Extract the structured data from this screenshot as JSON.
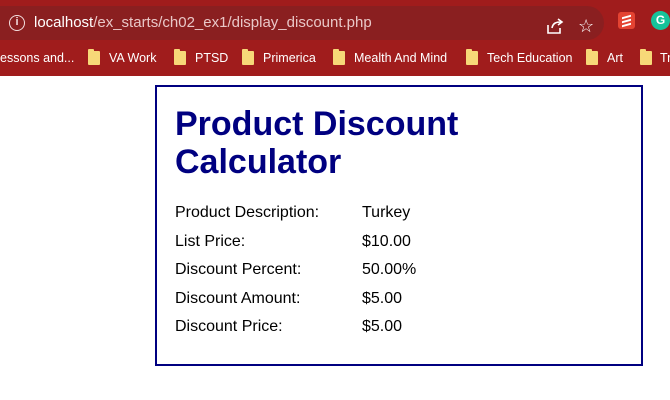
{
  "browser": {
    "url_host": "localhost",
    "url_path": "/ex_starts/ch02_ex1/display_discount.php",
    "extension_grammarly_letter": "G"
  },
  "bookmarks": [
    {
      "label": "essons and...",
      "folder": false
    },
    {
      "label": "VA Work",
      "folder": true
    },
    {
      "label": "PTSD",
      "folder": true
    },
    {
      "label": "Primerica",
      "folder": true
    },
    {
      "label": "Mealth And Mind",
      "folder": true
    },
    {
      "label": "Tech Education",
      "folder": true
    },
    {
      "label": "Art",
      "folder": true
    },
    {
      "label": "Tr",
      "folder": true
    }
  ],
  "page": {
    "title": "Product Discount Calculator",
    "rows": [
      {
        "label": "Product Description:",
        "value": "Turkey"
      },
      {
        "label": "List Price:",
        "value": "$10.00"
      },
      {
        "label": "Discount Percent:",
        "value": "50.00%"
      },
      {
        "label": "Discount Amount:",
        "value": "$5.00"
      },
      {
        "label": "Discount Price:",
        "value": "$5.00"
      }
    ]
  },
  "colors": {
    "chrome": "#a01c1c",
    "title": "#000080",
    "card_border": "#000080"
  }
}
